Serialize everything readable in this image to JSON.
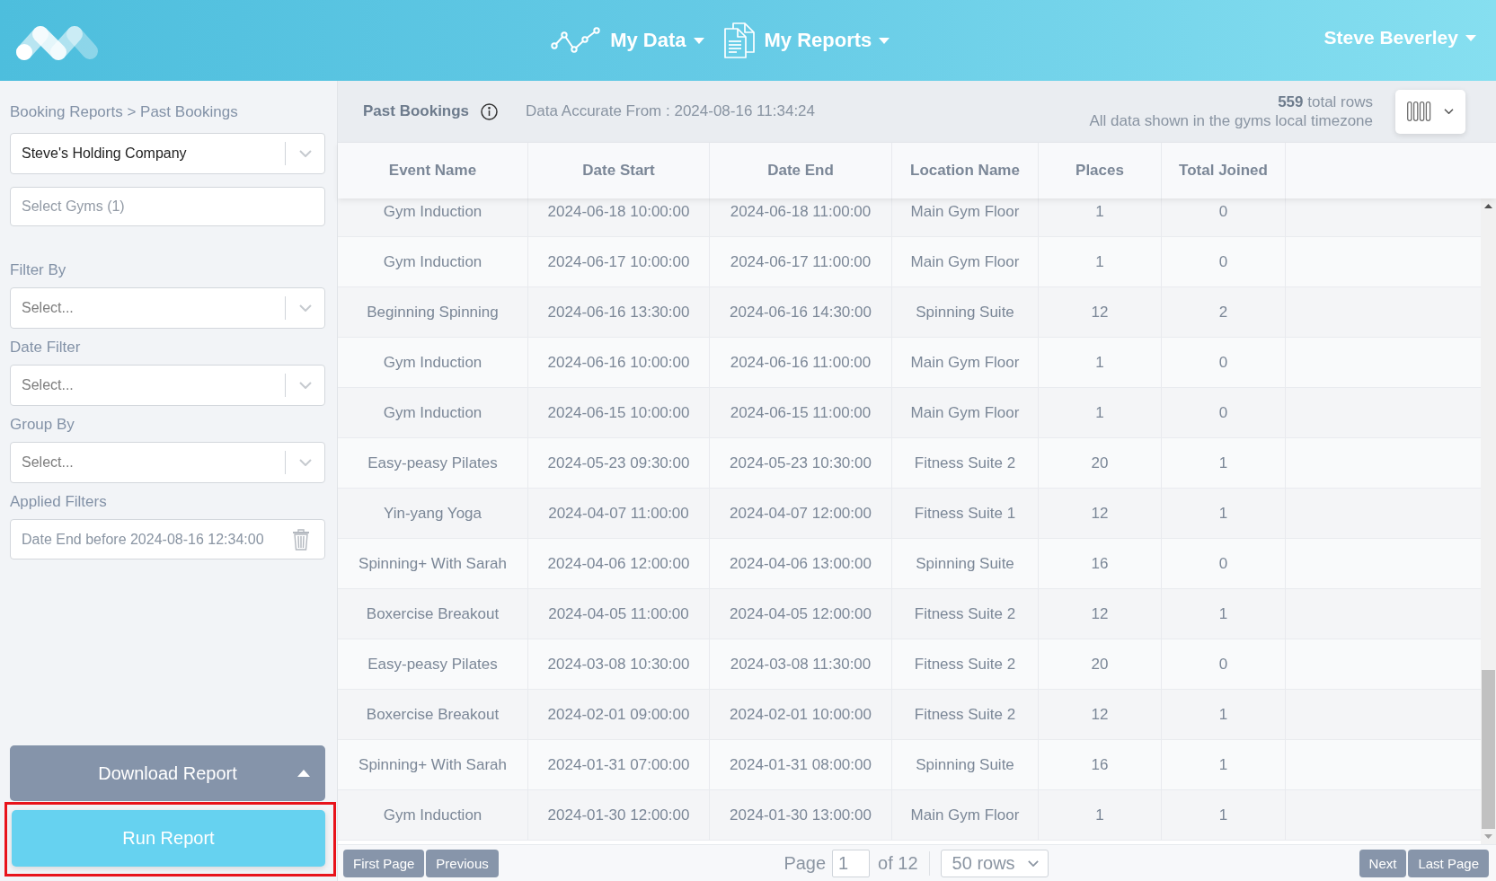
{
  "header": {
    "nav": [
      {
        "kind": "chart",
        "label": "My Data"
      },
      {
        "kind": "document",
        "label": "My Reports"
      }
    ],
    "user": {
      "name": "Steve Beverley"
    }
  },
  "sidebar": {
    "breadcrumb": "Booking Reports > Past Bookings",
    "company_select": {
      "value": "Steve's Holding Company"
    },
    "gyms_field": {
      "placeholder": "Select Gyms (1)"
    },
    "filters": [
      {
        "label": "Filter By",
        "placeholder": "Select..."
      },
      {
        "label": "Date Filter",
        "placeholder": "Select..."
      },
      {
        "label": "Group By",
        "placeholder": "Select..."
      }
    ],
    "applied_filters": {
      "label": "Applied Filters",
      "items": [
        "Date End before 2024-08-16 12:34:00"
      ]
    },
    "download_button": {
      "label": "Download Report"
    },
    "run_button": {
      "label": "Run Report",
      "highlighted": true
    }
  },
  "report": {
    "title": "Past Bookings",
    "accuracy": "Data Accurate From : 2024-08-16 11:34:24",
    "total_rows": "**559** total rows",
    "timezone_note": "All data shown in the gyms local timezone"
  },
  "table": {
    "columns": [
      "Event Name",
      "Date Start",
      "Date End",
      "Location Name",
      "Places",
      "Total Joined"
    ],
    "rows": [
      [
        "Gym Induction",
        "2024-06-18 10:00:00",
        "2024-06-18 11:00:00",
        "Main Gym Floor",
        "1",
        "0"
      ],
      [
        "Gym Induction",
        "2024-06-17 10:00:00",
        "2024-06-17 11:00:00",
        "Main Gym Floor",
        "1",
        "0"
      ],
      [
        "Beginning Spinning",
        "2024-06-16 13:30:00",
        "2024-06-16 14:30:00",
        "Spinning Suite",
        "12",
        "2"
      ],
      [
        "Gym Induction",
        "2024-06-16 10:00:00",
        "2024-06-16 11:00:00",
        "Main Gym Floor",
        "1",
        "0"
      ],
      [
        "Gym Induction",
        "2024-06-15 10:00:00",
        "2024-06-15 11:00:00",
        "Main Gym Floor",
        "1",
        "0"
      ],
      [
        "Easy-peasy Pilates",
        "2024-05-23 09:30:00",
        "2024-05-23 10:30:00",
        "Fitness Suite 2",
        "20",
        "1"
      ],
      [
        "Yin-yang Yoga",
        "2024-04-07 11:00:00",
        "2024-04-07 12:00:00",
        "Fitness Suite 1",
        "12",
        "1"
      ],
      [
        "Spinning+ With Sarah",
        "2024-04-06 12:00:00",
        "2024-04-06 13:00:00",
        "Spinning Suite",
        "16",
        "0"
      ],
      [
        "Boxercise Breakout",
        "2024-04-05 11:00:00",
        "2024-04-05 12:00:00",
        "Fitness Suite 2",
        "12",
        "1"
      ],
      [
        "Easy-peasy Pilates",
        "2024-03-08 10:30:00",
        "2024-03-08 11:30:00",
        "Fitness Suite 2",
        "20",
        "0"
      ],
      [
        "Boxercise Breakout",
        "2024-02-01 09:00:00",
        "2024-02-01 10:00:00",
        "Fitness Suite 2",
        "12",
        "1"
      ],
      [
        "Spinning+ With Sarah",
        "2024-01-31 07:00:00",
        "2024-01-31 08:00:00",
        "Spinning Suite",
        "16",
        "1"
      ],
      [
        "Gym Induction",
        "2024-01-30 12:00:00",
        "2024-01-30 13:00:00",
        "Main Gym Floor",
        "1",
        "1"
      ]
    ]
  },
  "pager": {
    "first": "First Page",
    "previous": "Previous",
    "page_label": "Page",
    "page_value": "1",
    "page_total": "of 12",
    "rows_select": "50 rows",
    "next": "Next",
    "last": "Last Page"
  }
}
